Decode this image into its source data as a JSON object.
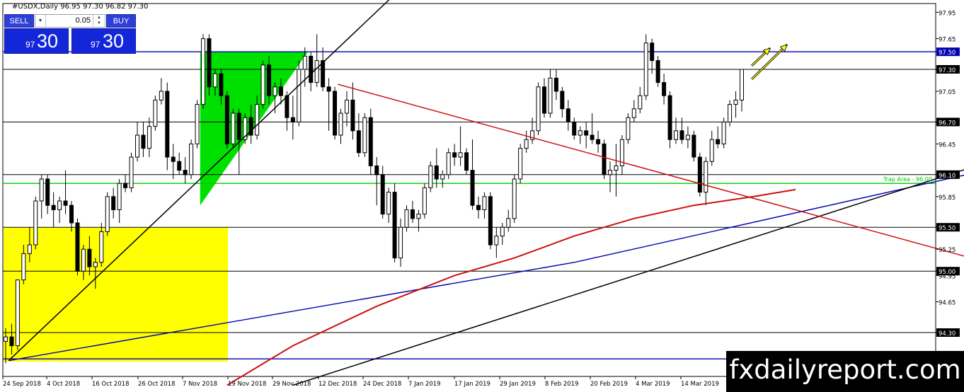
{
  "header": {
    "text": "#USDX,Daily  96.95 97.30 96.82 97.30"
  },
  "trade_panel": {
    "sell_label": "SELL",
    "buy_label": "BUY",
    "lot_value": "0.05",
    "sell_price_small": "97",
    "sell_price_big": "30",
    "buy_price_small": "97",
    "buy_price_big": "30"
  },
  "watermark": "fxdailyreport.com",
  "colors": {
    "background": "#ffffff",
    "bull_candle": "#ffffff",
    "bear_candle": "#000000",
    "yellow_zone": "#ffff00",
    "green_zone": "#00e000",
    "blue_line": "#0000b0",
    "red_line": "#cc1010",
    "green_line": "#00c800",
    "arrow": "#ffff00",
    "panel_blue": "#1427d8"
  },
  "chart_data": {
    "type": "candlestick",
    "symbol": "#USDX",
    "timeframe": "Daily",
    "last_ohlc": {
      "open": 96.95,
      "high": 97.3,
      "low": 96.82,
      "close": 97.3
    },
    "ylim": [
      93.8,
      98.05
    ],
    "y_ticks": [
      "97.95",
      "97.65",
      "97.50",
      "97.30",
      "97.05",
      "96.70",
      "96.45",
      "96.10",
      "95.85",
      "95.50",
      "95.25",
      "95.00",
      "94.95",
      "94.65",
      "94.30",
      "94.05",
      "94.00"
    ],
    "x_tick_labels": [
      "24 Sep 2018",
      "4 Oct 2018",
      "16 Oct 2018",
      "26 Oct 2018",
      "7 Nov 2018",
      "19 Nov 2018",
      "29 Nov 2018",
      "12 Dec 2018",
      "24 Dec 2018",
      "7 Jan 2019",
      "17 Jan 2019",
      "29 Jan 2019",
      "8 Feb 2019",
      "20 Feb 2019",
      "4 Mar 2019",
      "14 Mar 2019"
    ],
    "horizontal_levels": [
      {
        "price": 97.5,
        "label": "97.50",
        "color": "#0000b0",
        "boxed": true
      },
      {
        "price": 97.3,
        "label": "97.30",
        "color": "#000000",
        "boxed": true
      },
      {
        "price": 96.7,
        "label": "96.70",
        "color": "#000000",
        "boxed": true
      },
      {
        "price": 96.1,
        "label": "96.10",
        "color": "#000000",
        "boxed": true
      },
      {
        "price": 96.0,
        "label": "",
        "color": "#00c800",
        "boxed": false
      },
      {
        "price": 95.5,
        "label": "95.50",
        "color": "#000000",
        "boxed": true
      },
      {
        "price": 95.0,
        "label": "95.00",
        "color": "#000000",
        "boxed": true
      },
      {
        "price": 94.3,
        "label": "94.30",
        "color": "#000000",
        "boxed": true
      },
      {
        "price": 94.0,
        "label": "94.00",
        "color": "#0000b0",
        "boxed": true
      }
    ],
    "annotation": "Trap Area - 96.00",
    "candles": [
      {
        "o": 94.2,
        "h": 94.35,
        "l": 93.95,
        "c": 94.25
      },
      {
        "o": 94.25,
        "h": 94.4,
        "l": 94.05,
        "c": 94.15
      },
      {
        "o": 94.15,
        "h": 94.9,
        "l": 94.1,
        "c": 94.9
      },
      {
        "o": 94.9,
        "h": 95.3,
        "l": 94.85,
        "c": 95.2
      },
      {
        "o": 95.2,
        "h": 95.5,
        "l": 95.1,
        "c": 95.3
      },
      {
        "o": 95.3,
        "h": 95.85,
        "l": 95.25,
        "c": 95.8
      },
      {
        "o": 95.8,
        "h": 96.1,
        "l": 95.6,
        "c": 96.05
      },
      {
        "o": 96.05,
        "h": 96.1,
        "l": 95.65,
        "c": 95.75
      },
      {
        "o": 95.75,
        "h": 95.9,
        "l": 95.5,
        "c": 95.7
      },
      {
        "o": 95.7,
        "h": 95.85,
        "l": 95.55,
        "c": 95.8
      },
      {
        "o": 95.8,
        "h": 96.15,
        "l": 95.65,
        "c": 95.75
      },
      {
        "o": 95.75,
        "h": 95.8,
        "l": 95.45,
        "c": 95.55
      },
      {
        "o": 95.55,
        "h": 95.6,
        "l": 94.95,
        "c": 95.0
      },
      {
        "o": 95.0,
        "h": 95.3,
        "l": 94.9,
        "c": 95.25
      },
      {
        "o": 95.25,
        "h": 95.4,
        "l": 94.95,
        "c": 95.05
      },
      {
        "o": 95.05,
        "h": 95.15,
        "l": 94.8,
        "c": 95.1
      },
      {
        "o": 95.1,
        "h": 95.55,
        "l": 95.05,
        "c": 95.45
      },
      {
        "o": 95.45,
        "h": 95.9,
        "l": 95.4,
        "c": 95.85
      },
      {
        "o": 95.85,
        "h": 95.95,
        "l": 95.6,
        "c": 95.7
      },
      {
        "o": 95.7,
        "h": 96.05,
        "l": 95.55,
        "c": 96.0
      },
      {
        "o": 96.0,
        "h": 96.1,
        "l": 95.9,
        "c": 95.95
      },
      {
        "o": 95.95,
        "h": 96.35,
        "l": 95.9,
        "c": 96.3
      },
      {
        "o": 96.3,
        "h": 96.7,
        "l": 96.25,
        "c": 96.55
      },
      {
        "o": 96.55,
        "h": 96.7,
        "l": 96.3,
        "c": 96.4
      },
      {
        "o": 96.4,
        "h": 96.75,
        "l": 96.3,
        "c": 96.65
      },
      {
        "o": 96.65,
        "h": 97.0,
        "l": 96.6,
        "c": 96.95
      },
      {
        "o": 96.95,
        "h": 97.2,
        "l": 96.9,
        "c": 97.05
      },
      {
        "o": 97.05,
        "h": 97.15,
        "l": 96.15,
        "c": 96.3
      },
      {
        "o": 96.3,
        "h": 96.45,
        "l": 96.05,
        "c": 96.25
      },
      {
        "o": 96.25,
        "h": 96.35,
        "l": 96.1,
        "c": 96.15
      },
      {
        "o": 96.15,
        "h": 96.3,
        "l": 96.0,
        "c": 96.1
      },
      {
        "o": 96.1,
        "h": 96.5,
        "l": 96.05,
        "c": 96.45
      },
      {
        "o": 96.45,
        "h": 96.95,
        "l": 96.4,
        "c": 96.9
      },
      {
        "o": 96.9,
        "h": 97.7,
        "l": 96.85,
        "c": 97.65
      },
      {
        "o": 97.65,
        "h": 97.7,
        "l": 97.0,
        "c": 97.1
      },
      {
        "o": 97.1,
        "h": 97.3,
        "l": 97.0,
        "c": 97.25
      },
      {
        "o": 97.25,
        "h": 97.3,
        "l": 96.9,
        "c": 97.0
      },
      {
        "o": 97.0,
        "h": 97.05,
        "l": 96.4,
        "c": 96.45
      },
      {
        "o": 96.45,
        "h": 96.85,
        "l": 96.4,
        "c": 96.8
      },
      {
        "o": 96.8,
        "h": 96.85,
        "l": 96.1,
        "c": 96.5
      },
      {
        "o": 96.5,
        "h": 96.8,
        "l": 96.45,
        "c": 96.75
      },
      {
        "o": 96.75,
        "h": 96.9,
        "l": 96.45,
        "c": 96.55
      },
      {
        "o": 96.55,
        "h": 97.0,
        "l": 96.5,
        "c": 96.9
      },
      {
        "o": 96.9,
        "h": 97.4,
        "l": 96.85,
        "c": 97.35
      },
      {
        "o": 97.35,
        "h": 97.45,
        "l": 96.9,
        "c": 97.0
      },
      {
        "o": 97.0,
        "h": 97.15,
        "l": 96.8,
        "c": 97.1
      },
      {
        "o": 97.1,
        "h": 97.2,
        "l": 96.9,
        "c": 97.0
      },
      {
        "o": 97.0,
        "h": 97.05,
        "l": 96.6,
        "c": 96.75
      },
      {
        "o": 96.75,
        "h": 97.0,
        "l": 96.5,
        "c": 96.7
      },
      {
        "o": 96.7,
        "h": 97.4,
        "l": 96.65,
        "c": 97.3
      },
      {
        "o": 97.3,
        "h": 97.55,
        "l": 97.1,
        "c": 97.45
      },
      {
        "o": 97.45,
        "h": 97.5,
        "l": 97.05,
        "c": 97.15
      },
      {
        "o": 97.15,
        "h": 97.7,
        "l": 97.1,
        "c": 97.4
      },
      {
        "o": 97.4,
        "h": 97.55,
        "l": 97.05,
        "c": 97.1
      },
      {
        "o": 97.1,
        "h": 97.2,
        "l": 96.6,
        "c": 97.05
      },
      {
        "o": 97.05,
        "h": 97.1,
        "l": 96.5,
        "c": 96.55
      },
      {
        "o": 96.55,
        "h": 96.85,
        "l": 96.45,
        "c": 96.8
      },
      {
        "o": 96.8,
        "h": 97.05,
        "l": 96.65,
        "c": 96.95
      },
      {
        "o": 96.95,
        "h": 97.15,
        "l": 96.5,
        "c": 96.6
      },
      {
        "o": 96.6,
        "h": 96.8,
        "l": 96.3,
        "c": 96.35
      },
      {
        "o": 96.35,
        "h": 96.8,
        "l": 96.3,
        "c": 96.75
      },
      {
        "o": 96.75,
        "h": 96.85,
        "l": 96.1,
        "c": 96.2
      },
      {
        "o": 96.2,
        "h": 96.3,
        "l": 95.75,
        "c": 96.1
      },
      {
        "o": 96.1,
        "h": 96.2,
        "l": 95.6,
        "c": 95.65
      },
      {
        "o": 95.65,
        "h": 95.95,
        "l": 95.55,
        "c": 95.9
      },
      {
        "o": 95.9,
        "h": 96.0,
        "l": 95.1,
        "c": 95.15
      },
      {
        "o": 95.15,
        "h": 95.6,
        "l": 95.05,
        "c": 95.5
      },
      {
        "o": 95.5,
        "h": 95.75,
        "l": 95.45,
        "c": 95.7
      },
      {
        "o": 95.7,
        "h": 95.8,
        "l": 95.55,
        "c": 95.6
      },
      {
        "o": 95.6,
        "h": 95.7,
        "l": 95.45,
        "c": 95.65
      },
      {
        "o": 95.65,
        "h": 96.0,
        "l": 95.6,
        "c": 95.95
      },
      {
        "o": 95.95,
        "h": 96.25,
        "l": 95.9,
        "c": 96.2
      },
      {
        "o": 96.2,
        "h": 96.4,
        "l": 95.95,
        "c": 96.05
      },
      {
        "o": 96.05,
        "h": 96.15,
        "l": 95.95,
        "c": 96.1
      },
      {
        "o": 96.1,
        "h": 96.4,
        "l": 96.05,
        "c": 96.35
      },
      {
        "o": 96.35,
        "h": 96.45,
        "l": 96.2,
        "c": 96.3
      },
      {
        "o": 96.3,
        "h": 96.65,
        "l": 96.2,
        "c": 96.35
      },
      {
        "o": 96.35,
        "h": 96.4,
        "l": 96.1,
        "c": 96.15
      },
      {
        "o": 96.15,
        "h": 96.5,
        "l": 95.7,
        "c": 95.75
      },
      {
        "o": 95.75,
        "h": 95.85,
        "l": 95.6,
        "c": 95.7
      },
      {
        "o": 95.7,
        "h": 95.9,
        "l": 95.6,
        "c": 95.85
      },
      {
        "o": 95.85,
        "h": 95.9,
        "l": 95.25,
        "c": 95.3
      },
      {
        "o": 95.3,
        "h": 95.5,
        "l": 95.15,
        "c": 95.4
      },
      {
        "o": 95.4,
        "h": 95.55,
        "l": 95.3,
        "c": 95.5
      },
      {
        "o": 95.5,
        "h": 95.7,
        "l": 95.45,
        "c": 95.6
      },
      {
        "o": 95.6,
        "h": 96.1,
        "l": 95.55,
        "c": 96.05
      },
      {
        "o": 96.05,
        "h": 96.45,
        "l": 96.0,
        "c": 96.4
      },
      {
        "o": 96.4,
        "h": 96.6,
        "l": 96.35,
        "c": 96.5
      },
      {
        "o": 96.5,
        "h": 96.75,
        "l": 96.45,
        "c": 96.6
      },
      {
        "o": 96.6,
        "h": 97.15,
        "l": 96.55,
        "c": 97.1
      },
      {
        "o": 97.1,
        "h": 97.2,
        "l": 96.75,
        "c": 96.8
      },
      {
        "o": 96.8,
        "h": 97.3,
        "l": 96.75,
        "c": 97.2
      },
      {
        "o": 97.2,
        "h": 97.3,
        "l": 96.95,
        "c": 97.05
      },
      {
        "o": 97.05,
        "h": 97.1,
        "l": 96.75,
        "c": 96.85
      },
      {
        "o": 96.85,
        "h": 96.95,
        "l": 96.6,
        "c": 96.7
      },
      {
        "o": 96.7,
        "h": 96.75,
        "l": 96.5,
        "c": 96.55
      },
      {
        "o": 96.55,
        "h": 96.65,
        "l": 96.45,
        "c": 96.6
      },
      {
        "o": 96.6,
        "h": 96.7,
        "l": 96.4,
        "c": 96.55
      },
      {
        "o": 96.55,
        "h": 96.8,
        "l": 96.45,
        "c": 96.5
      },
      {
        "o": 96.5,
        "h": 96.6,
        "l": 96.35,
        "c": 96.45
      },
      {
        "o": 96.45,
        "h": 96.5,
        "l": 96.05,
        "c": 96.1
      },
      {
        "o": 96.1,
        "h": 96.25,
        "l": 95.9,
        "c": 96.15
      },
      {
        "o": 96.15,
        "h": 96.45,
        "l": 95.85,
        "c": 96.2
      },
      {
        "o": 96.2,
        "h": 96.55,
        "l": 96.1,
        "c": 96.5
      },
      {
        "o": 96.5,
        "h": 96.8,
        "l": 96.45,
        "c": 96.75
      },
      {
        "o": 96.75,
        "h": 96.95,
        "l": 96.7,
        "c": 96.85
      },
      {
        "o": 96.85,
        "h": 97.1,
        "l": 96.8,
        "c": 97.0
      },
      {
        "o": 97.0,
        "h": 97.7,
        "l": 96.95,
        "c": 97.6
      },
      {
        "o": 97.6,
        "h": 97.65,
        "l": 97.25,
        "c": 97.4
      },
      {
        "o": 97.4,
        "h": 97.45,
        "l": 97.1,
        "c": 97.15
      },
      {
        "o": 97.15,
        "h": 97.25,
        "l": 96.9,
        "c": 97.0
      },
      {
        "o": 97.0,
        "h": 97.05,
        "l": 96.4,
        "c": 96.5
      },
      {
        "o": 96.5,
        "h": 96.75,
        "l": 96.45,
        "c": 96.6
      },
      {
        "o": 96.6,
        "h": 96.75,
        "l": 96.45,
        "c": 96.5
      },
      {
        "o": 96.5,
        "h": 96.65,
        "l": 96.4,
        "c": 96.55
      },
      {
        "o": 96.55,
        "h": 96.6,
        "l": 96.25,
        "c": 96.3
      },
      {
        "o": 96.3,
        "h": 96.35,
        "l": 95.85,
        "c": 95.9
      },
      {
        "o": 95.9,
        "h": 96.3,
        "l": 95.75,
        "c": 96.25
      },
      {
        "o": 96.25,
        "h": 96.6,
        "l": 96.2,
        "c": 96.5
      },
      {
        "o": 96.5,
        "h": 96.65,
        "l": 96.4,
        "c": 96.45
      },
      {
        "o": 96.45,
        "h": 96.75,
        "l": 96.4,
        "c": 96.7
      },
      {
        "o": 96.7,
        "h": 96.95,
        "l": 96.65,
        "c": 96.9
      },
      {
        "o": 96.9,
        "h": 97.05,
        "l": 96.75,
        "c": 96.95
      },
      {
        "o": 96.95,
        "h": 97.3,
        "l": 96.82,
        "c": 97.3
      }
    ]
  }
}
